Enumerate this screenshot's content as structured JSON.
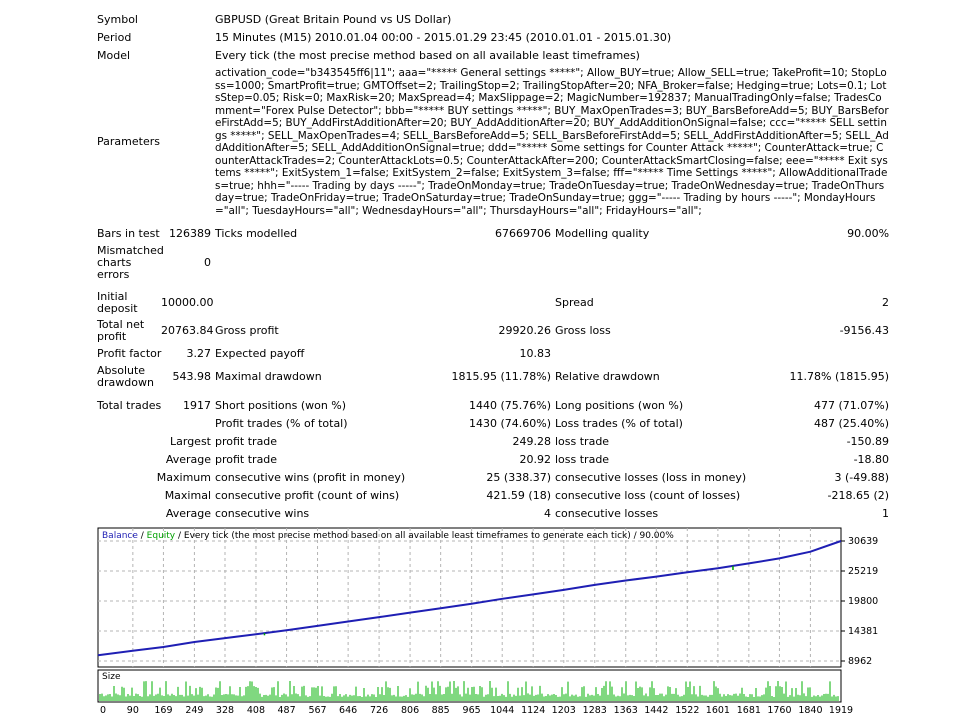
{
  "report": {
    "symbol_label": "Symbol",
    "symbol_value": "GBPUSD (Great Britain Pound vs US Dollar)",
    "period_label": "Period",
    "period_value": "15 Minutes (M15) 2010.01.04 00:00 - 2015.01.29 23:45 (2010.01.01 - 2015.01.30)",
    "model_label": "Model",
    "model_value": "Every tick (the most precise method based on all available least timeframes)",
    "parameters_label": "Parameters",
    "parameters_value": "activation_code=\"b343545ff6|11\"; aaa=\"***** General settings *****\"; Allow_BUY=true; Allow_SELL=true; TakeProfit=10; StopLoss=1000; SmartProfit=true; GMTOffset=2; TrailingStop=2; TrailingStopAfter=20; NFA_Broker=false; Hedging=true; Lots=0.1; LotsStep=0.05; Risk=0; MaxRisk=20; MaxSpread=4; MaxSlippage=2; MagicNumber=192837; ManualTradingOnly=false; TradesComment=\"Forex Pulse Detector\"; bbb=\"***** BUY settings *****\"; BUY_MaxOpenTrades=3; BUY_BarsBeforeAdd=5; BUY_BarsBeforeFirstAdd=5; BUY_AddFirstAdditionAfter=20; BUY_AddAdditionAfter=20; BUY_AddAdditionOnSignal=false; ccc=\"***** SELL settings *****\"; SELL_MaxOpenTrades=4; SELL_BarsBeforeAdd=5; SELL_BarsBeforeFirstAdd=5; SELL_AddFirstAdditionAfter=5; SELL_AddAdditionAfter=5; SELL_AddAdditionOnSignal=true; ddd=\"***** Some settings for Counter Attack *****\"; CounterAttack=true; CounterAttackTrades=2; CounterAttackLots=0.5; CounterAttackAfter=200; CounterAttackSmartClosing=false; eee=\"***** Exit systems *****\"; ExitSystem_1=false; ExitSystem_2=false; ExitSystem_3=false; fff=\"***** Time Settings *****\"; AllowAdditionalTrades=true; hhh=\"----- Trading by days -----\"; TradeOnMonday=true; TradeOnTuesday=true; TradeOnWednesday=true; TradeOnThursday=true; TradeOnFriday=true; TradeOnSaturday=true; TradeOnSunday=true; ggg=\"----- Trading by hours -----\"; MondayHours=\"all\"; TuesdayHours=\"all\"; WednesdayHours=\"all\"; ThursdayHours=\"all\"; FridayHours=\"all\";",
    "bars_label": "Bars in test",
    "bars_value": "126389",
    "ticks_label": "Ticks modelled",
    "ticks_value": "67669706",
    "quality_label": "Modelling quality",
    "quality_value": "90.00%",
    "mismatch_label": "Mismatched charts errors",
    "mismatch_value": "0",
    "deposit_label": "Initial deposit",
    "deposit_value": "10000.00",
    "spread_label": "Spread",
    "spread_value": "2",
    "netprofit_label": "Total net profit",
    "netprofit_value": "20763.84",
    "grossprofit_label": "Gross profit",
    "grossprofit_value": "29920.26",
    "grossloss_label": "Gross loss",
    "grossloss_value": "-9156.43",
    "pf_label": "Profit factor",
    "pf_value": "3.27",
    "payoff_label": "Expected payoff",
    "payoff_value": "10.83",
    "absdd_label": "Absolute drawdown",
    "absdd_value": "543.98",
    "maxdd_label": "Maximal drawdown",
    "maxdd_value": "1815.95 (11.78%)",
    "reldd_label": "Relative drawdown",
    "reldd_value": "11.78% (1815.95)",
    "trades_label": "Total trades",
    "trades_value": "1917",
    "short_label": "Short positions (won %)",
    "short_value": "1440 (75.76%)",
    "long_label": "Long positions (won %)",
    "long_value": "477 (71.07%)",
    "ptrades_label": "Profit trades (% of total)",
    "ptrades_value": "1430 (74.60%)",
    "ltrades_label": "Loss trades (% of total)",
    "ltrades_value": "487 (25.40%)",
    "largest_label": "Largest",
    "largest_pt_label": "profit trade",
    "largest_pt_value": "249.28",
    "largest_lt_label": "loss trade",
    "largest_lt_value": "-150.89",
    "average_label": "Average",
    "average_pt_label": "profit trade",
    "average_pt_value": "20.92",
    "average_lt_label": "loss trade",
    "average_lt_value": "-18.80",
    "maximum_label": "Maximum",
    "max_cw_label": "consecutive wins (profit in money)",
    "max_cw_value": "25 (338.37)",
    "max_cl_label": "consecutive losses (loss in money)",
    "max_cl_value": "3 (-49.88)",
    "maximal_label": "Maximal",
    "maxl_cp_label": "consecutive profit (count of wins)",
    "maxl_cp_value": "421.59 (18)",
    "maxl_cl_label": "consecutive loss (count of losses)",
    "maxl_cl_value": "-218.65 (2)",
    "average2_label": "Average",
    "avg_cw_label": "consecutive wins",
    "avg_cw_value": "4",
    "avg_cl_label": "consecutive losses",
    "avg_cl_value": "1"
  },
  "chart_data": {
    "type": "line",
    "caption": {
      "balance": "Balance",
      "sep1": " / ",
      "equity": "Equity",
      "rest": " / Every tick (the most precise method based on all available least timeframes to generate each tick) / 90.00%"
    },
    "size_label": "Size",
    "colors": {
      "balance": "#1f1fb4",
      "equity": "#00a000",
      "size": "#00b000",
      "grid": "#b4b4b4"
    },
    "yticks": [
      30639,
      25219,
      19800,
      14381,
      8962
    ],
    "ylim": [
      8962,
      30639
    ],
    "xticks": [
      0,
      90,
      169,
      249,
      328,
      408,
      487,
      567,
      646,
      726,
      806,
      885,
      965,
      1044,
      1124,
      1203,
      1283,
      1363,
      1442,
      1522,
      1601,
      1681,
      1760,
      1840,
      1919
    ],
    "xlim": [
      0,
      1919
    ],
    "series": [
      {
        "name": "Balance",
        "x": [
          0,
          90,
          169,
          249,
          328,
          408,
          487,
          567,
          646,
          726,
          806,
          885,
          965,
          1044,
          1124,
          1203,
          1283,
          1363,
          1442,
          1522,
          1601,
          1681,
          1760,
          1840,
          1919
        ],
        "values": [
          10000,
          10800,
          11500,
          12400,
          13100,
          13800,
          14500,
          15300,
          16100,
          16900,
          17700,
          18500,
          19300,
          20200,
          21000,
          21800,
          22700,
          23500,
          24200,
          25000,
          25700,
          26600,
          27500,
          28700,
          30639
        ]
      }
    ],
    "equity_dips": [
      {
        "x": 430,
        "value": 13600
      },
      {
        "x": 1093,
        "value": 20700
      },
      {
        "x": 1370,
        "value": 23500
      },
      {
        "x": 1640,
        "value": 25400
      }
    ]
  }
}
